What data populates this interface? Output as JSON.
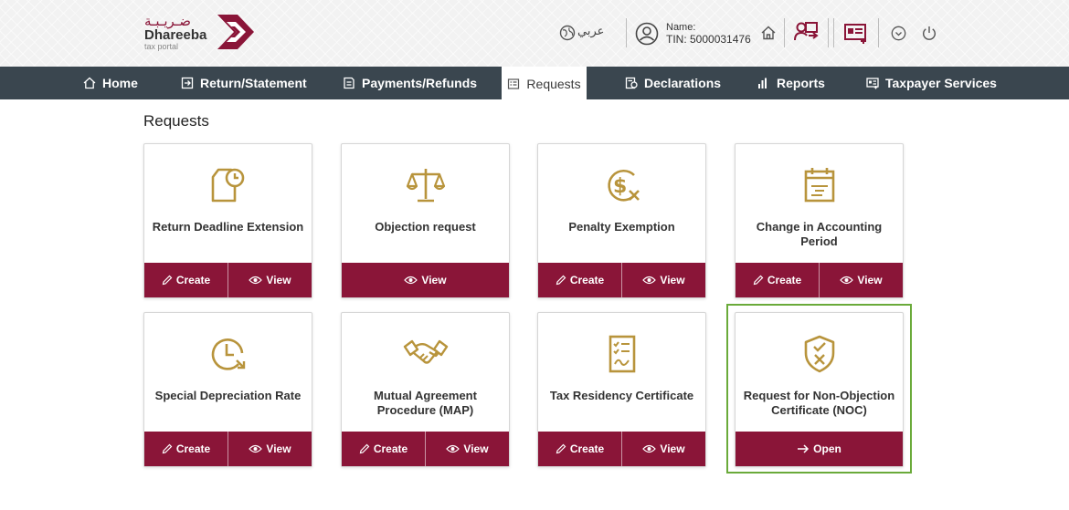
{
  "header": {
    "logo": {
      "arabic": "ضـريـبـة",
      "name": "Dhareeba",
      "sub": "tax portal"
    },
    "lang_label": "عربي",
    "user": {
      "name_label": "Name:",
      "tin": "TIN: 5000031476"
    }
  },
  "nav": {
    "items": [
      {
        "label": "Home"
      },
      {
        "label": "Return/Statement"
      },
      {
        "label": "Payments/Refunds"
      },
      {
        "label": "Requests"
      },
      {
        "label": "Declarations"
      },
      {
        "label": "Reports"
      },
      {
        "label": "Taxpayer Services"
      }
    ]
  },
  "page_title": "Requests",
  "actions": {
    "create": "Create",
    "view": "View",
    "open": "Open"
  },
  "cards": [
    {
      "title": "Return Deadline Extension",
      "icon": "document-clock-icon",
      "actions": [
        "Create",
        "View"
      ]
    },
    {
      "title": "Objection request",
      "icon": "scales-icon",
      "actions": [
        "View"
      ]
    },
    {
      "title": "Penalty Exemption",
      "icon": "dollar-exempt-icon",
      "actions": [
        "Create",
        "View"
      ]
    },
    {
      "title": "Change in Accounting Period",
      "icon": "calendar-icon",
      "actions": [
        "Create",
        "View"
      ]
    },
    {
      "title": "Special Depreciation Rate",
      "icon": "clock-down-icon",
      "actions": [
        "Create",
        "View"
      ]
    },
    {
      "title": "Mutual Agreement Procedure (MAP)",
      "icon": "handshake-icon",
      "actions": [
        "Create",
        "View"
      ]
    },
    {
      "title": "Tax Residency Certificate",
      "icon": "certificate-icon",
      "actions": [
        "Create",
        "View"
      ]
    },
    {
      "title": "Request for Non-Objection Certificate (NOC)",
      "icon": "shield-check-icon",
      "actions": [
        "Open"
      ]
    }
  ],
  "colors": {
    "brand": "#8a1538",
    "nav": "#3a464f",
    "icon_gold": "#b8943c",
    "highlight": "#6aaa3a"
  }
}
